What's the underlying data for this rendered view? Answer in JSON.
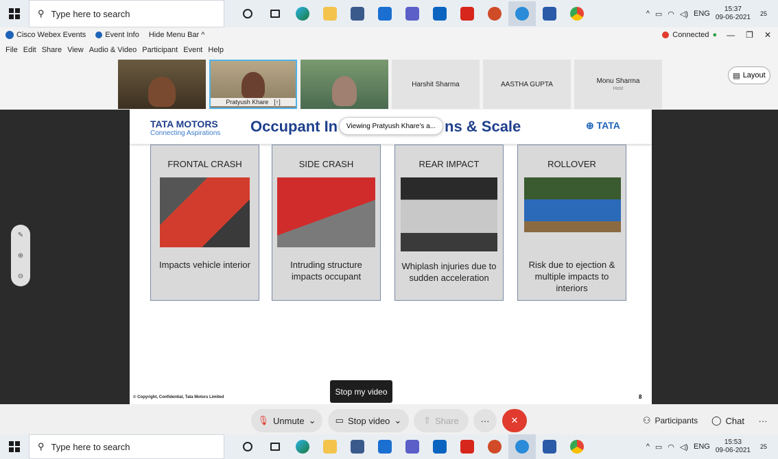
{
  "taskbar": {
    "search_placeholder": "Type here to search",
    "top_time": "15:37",
    "top_date": "09-06-2021",
    "bottom_time": "15:53",
    "bottom_date": "09-06-2021",
    "lang": "ENG",
    "notif_count": "25",
    "apps": [
      "cortana-icon",
      "task-view-icon",
      "edge-icon",
      "file-explorer-icon",
      "store-icon",
      "mail-icon",
      "teams-icon",
      "outlook-icon",
      "acrobat-icon",
      "powerpoint-icon",
      "webex-icon",
      "word-icon",
      "chrome-icon"
    ]
  },
  "webex": {
    "app_title": "Cisco Webex Events",
    "event_info": "Event Info",
    "hide_menu": "Hide Menu Bar ^",
    "status": "Connected",
    "menu": [
      "File",
      "Edit",
      "Share",
      "View",
      "Audio & Video",
      "Participant",
      "Event",
      "Help"
    ],
    "layout_label": "Layout"
  },
  "participants": [
    {
      "name": "Harshit Sharma",
      "role": ""
    },
    {
      "name": "AASTHA GUPTA",
      "role": ""
    },
    {
      "name": "Monu Sharma",
      "role": "Host"
    }
  ],
  "active_speaker": "Pratyush Khare",
  "viewing_banner": "Viewing Pratyush Khare's a...",
  "slide": {
    "brand": "TATA MOTORS",
    "brand_tag": "Connecting Aspirations",
    "title_left": "Occupant In",
    "title_right": "ns & Scale",
    "tata_logo": "TATA",
    "footer": "© Copyright, Confidential, Tata Motors Limited",
    "page": "8",
    "cards": [
      {
        "title": "FRONTAL CRASH",
        "desc": "Impacts vehicle interior"
      },
      {
        "title": "SIDE CRASH",
        "desc": "Intruding structure impacts occupant"
      },
      {
        "title": "REAR IMPACT",
        "desc": "Whiplash injuries due to sudden acceleration"
      },
      {
        "title": "ROLLOVER",
        "desc": "Risk due to ejection & multiple impacts to interiors"
      }
    ]
  },
  "controls": {
    "tooltip": "Stop my video",
    "unmute": "Unmute",
    "stop_video": "Stop video",
    "share": "Share",
    "more": "···",
    "participants": "Participants",
    "chat": "Chat"
  },
  "colors": {
    "accent": "#1e63b8",
    "end": "#e03b2e"
  }
}
